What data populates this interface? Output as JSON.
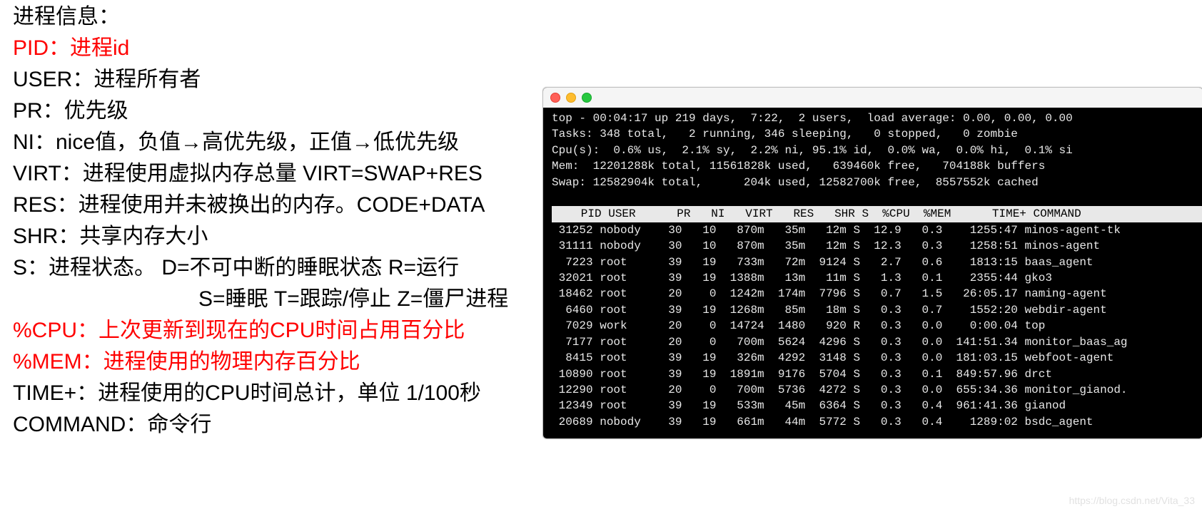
{
  "left": {
    "heading": "进程信息：",
    "lines": [
      {
        "text": "PID：进程id",
        "red": true
      },
      {
        "text": "USER：进程所有者",
        "red": false
      },
      {
        "text": "PR：优先级",
        "red": false
      },
      {
        "text": "NI：nice值，负值→高优先级，正值→低优先级",
        "red": false
      },
      {
        "text": "VIRT：进程使用虚拟内存总量 VIRT=SWAP+RES",
        "red": false
      },
      {
        "text": "RES：进程使用并未被换出的内存。CODE+DATA",
        "red": false
      },
      {
        "text": "SHR：共享内存大小",
        "red": false
      },
      {
        "text": "S：进程状态。 D=不可中断的睡眠状态 R=运行",
        "red": false
      },
      {
        "text": "S=睡眠 T=跟踪/停止 Z=僵尸进程",
        "red": false,
        "indent": true
      },
      {
        "text": "%CPU：上次更新到现在的CPU时间占用百分比",
        "red": true
      },
      {
        "text": "%MEM：进程使用的物理内存百分比",
        "red": true
      },
      {
        "text": "TIME+：进程使用的CPU时间总计，单位 1/100秒",
        "red": false
      },
      {
        "text": "COMMAND：命令行",
        "red": false
      }
    ]
  },
  "terminal": {
    "summary": [
      "top - 00:04:17 up 219 days,  7:22,  2 users,  load average: 0.00, 0.00, 0.00",
      "Tasks: 348 total,   2 running, 346 sleeping,   0 stopped,   0 zombie",
      "Cpu(s):  0.6% us,  2.1% sy,  2.2% ni, 95.1% id,  0.0% wa,  0.0% hi,  0.1% si",
      "Mem:  12201288k total, 11561828k used,   639460k free,   704188k buffers",
      "Swap: 12582904k total,      204k used, 12582700k free,  8557552k cached"
    ],
    "columns": [
      "PID",
      "USER",
      "PR",
      "NI",
      "VIRT",
      "RES",
      "SHR",
      "S",
      "%CPU",
      "%MEM",
      "TIME+",
      "COMMAND"
    ],
    "rows": [
      {
        "pid": "31252",
        "user": "nobody",
        "pr": "30",
        "ni": "10",
        "virt": "870m",
        "res": "35m",
        "shr": "12m",
        "s": "S",
        "cpu": "12.9",
        "mem": "0.3",
        "time": "1255:47",
        "cmd": "minos-agent-tk"
      },
      {
        "pid": "31111",
        "user": "nobody",
        "pr": "30",
        "ni": "10",
        "virt": "870m",
        "res": "35m",
        "shr": "12m",
        "s": "S",
        "cpu": "12.3",
        "mem": "0.3",
        "time": "1258:51",
        "cmd": "minos-agent"
      },
      {
        "pid": "7223",
        "user": "root",
        "pr": "39",
        "ni": "19",
        "virt": "733m",
        "res": "72m",
        "shr": "9124",
        "s": "S",
        "cpu": "2.7",
        "mem": "0.6",
        "time": "1813:15",
        "cmd": "baas_agent"
      },
      {
        "pid": "32021",
        "user": "root",
        "pr": "39",
        "ni": "19",
        "virt": "1388m",
        "res": "13m",
        "shr": "11m",
        "s": "S",
        "cpu": "1.3",
        "mem": "0.1",
        "time": "2355:44",
        "cmd": "gko3"
      },
      {
        "pid": "18462",
        "user": "root",
        "pr": "20",
        "ni": "0",
        "virt": "1242m",
        "res": "174m",
        "shr": "7796",
        "s": "S",
        "cpu": "0.7",
        "mem": "1.5",
        "time": "26:05.17",
        "cmd": "naming-agent"
      },
      {
        "pid": "6460",
        "user": "root",
        "pr": "39",
        "ni": "19",
        "virt": "1268m",
        "res": "85m",
        "shr": "18m",
        "s": "S",
        "cpu": "0.3",
        "mem": "0.7",
        "time": "1552:20",
        "cmd": "webdir-agent"
      },
      {
        "pid": "7029",
        "user": "work",
        "pr": "20",
        "ni": "0",
        "virt": "14724",
        "res": "1480",
        "shr": "920",
        "s": "R",
        "cpu": "0.3",
        "mem": "0.0",
        "time": "0:00.04",
        "cmd": "top"
      },
      {
        "pid": "7177",
        "user": "root",
        "pr": "20",
        "ni": "0",
        "virt": "700m",
        "res": "5624",
        "shr": "4296",
        "s": "S",
        "cpu": "0.3",
        "mem": "0.0",
        "time": "141:51.34",
        "cmd": "monitor_baas_ag"
      },
      {
        "pid": "8415",
        "user": "root",
        "pr": "39",
        "ni": "19",
        "virt": "326m",
        "res": "4292",
        "shr": "3148",
        "s": "S",
        "cpu": "0.3",
        "mem": "0.0",
        "time": "181:03.15",
        "cmd": "webfoot-agent"
      },
      {
        "pid": "10890",
        "user": "root",
        "pr": "39",
        "ni": "19",
        "virt": "1891m",
        "res": "9176",
        "shr": "5704",
        "s": "S",
        "cpu": "0.3",
        "mem": "0.1",
        "time": "849:57.96",
        "cmd": "drct"
      },
      {
        "pid": "12290",
        "user": "root",
        "pr": "20",
        "ni": "0",
        "virt": "700m",
        "res": "5736",
        "shr": "4272",
        "s": "S",
        "cpu": "0.3",
        "mem": "0.0",
        "time": "655:34.36",
        "cmd": "monitor_gianod."
      },
      {
        "pid": "12349",
        "user": "root",
        "pr": "39",
        "ni": "19",
        "virt": "533m",
        "res": "45m",
        "shr": "6364",
        "s": "S",
        "cpu": "0.3",
        "mem": "0.4",
        "time": "961:41.36",
        "cmd": "gianod"
      },
      {
        "pid": "20689",
        "user": "nobody",
        "pr": "39",
        "ni": "19",
        "virt": "661m",
        "res": "44m",
        "shr": "5772",
        "s": "S",
        "cpu": "0.3",
        "mem": "0.4",
        "time": "1289:02",
        "cmd": "bsdc_agent"
      }
    ]
  },
  "watermark": "https://blog.csdn.net/Vita_33",
  "colwidths": {
    "pid": 6,
    "user": 7,
    "pr": 4,
    "ni": 4,
    "virt": 6,
    "res": 5,
    "shr": 5,
    "s": 2,
    "cpu": 5,
    "mem": 5,
    "time": 10,
    "cmd": 0
  }
}
